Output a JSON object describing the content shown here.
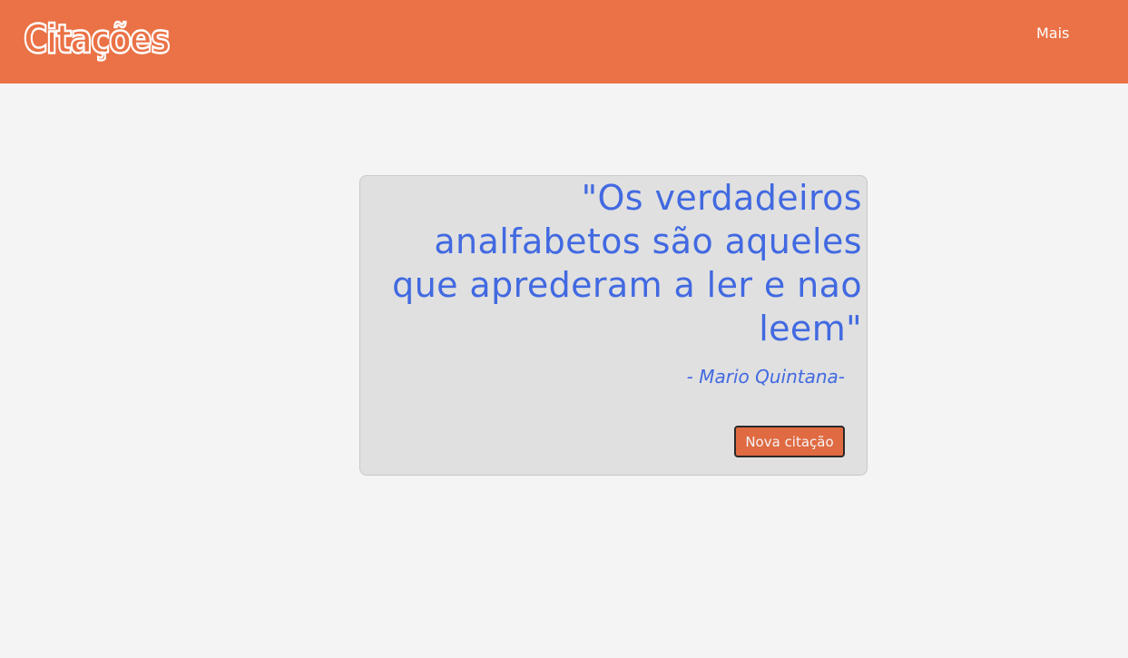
{
  "header": {
    "logo_text": "Citações",
    "nav_more_label": "Mais"
  },
  "quote_card": {
    "quote_text": "\"Os verdadeiros analfabetos são aqueles que aprederam a ler e nao leem\"",
    "author": "- Mario Quintana-",
    "new_quote_label": "Nova citação"
  },
  "colors": {
    "header_bg": "#ea7246",
    "page_bg": "#f4f4f4",
    "card_bg": "#e0e0e0",
    "quote_text": "#4169e1",
    "button_bg": "#e06a42"
  }
}
